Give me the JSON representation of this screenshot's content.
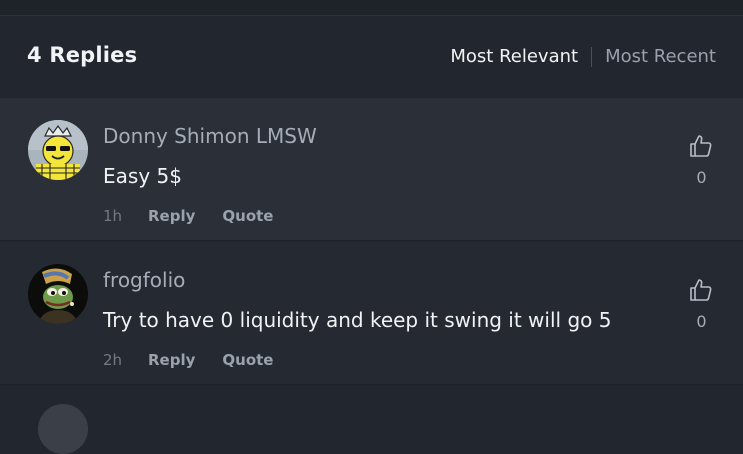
{
  "header": {
    "replies_count": "4 Replies",
    "sort_options": [
      "Most Relevant",
      "Most Recent"
    ],
    "active_sort": "Most Relevant"
  },
  "comments": [
    {
      "author": "Donny Shimon LMSW",
      "text": "Easy 5$",
      "time": "1h",
      "reply_label": "Reply",
      "quote_label": "Quote",
      "likes": "0",
      "avatar_icon": "crowned-smiley-avatar"
    },
    {
      "author": "frogfolio",
      "text": "Try to have 0 liquidity and keep it swing it will go 5",
      "time": "2h",
      "reply_label": "Reply",
      "quote_label": "Quote",
      "likes": "0",
      "avatar_icon": "frog-portrait-avatar"
    }
  ],
  "colors": {
    "background": "#22272f",
    "highlight_row": "#2b3038",
    "text_primary": "#f0f2f4",
    "text_secondary": "#a6adb6"
  }
}
